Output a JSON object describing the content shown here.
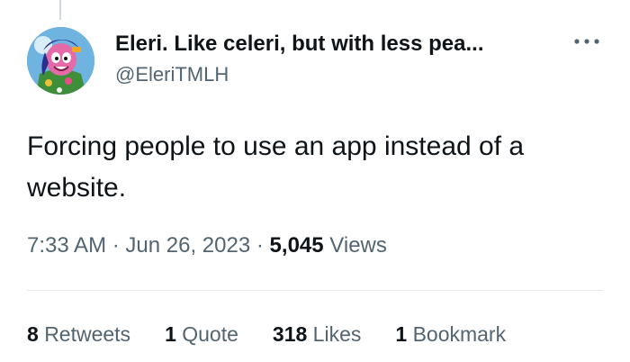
{
  "tweet": {
    "author": {
      "display_name": "Eleri. Like celeri, but with less pea...",
      "handle": "@EleriTMLH"
    },
    "text": "Forcing people to use an app instead of a website.",
    "time": "7:33 AM",
    "date": "Jun 26, 2023",
    "separator": "·",
    "views_count": "5,045",
    "views_label": "Views",
    "stats": {
      "retweets_count": "8",
      "retweets_label": "Retweets",
      "quotes_count": "1",
      "quotes_label": "Quote",
      "likes_count": "318",
      "likes_label": "Likes",
      "bookmarks_count": "1",
      "bookmarks_label": "Bookmark"
    }
  },
  "icons": {
    "more": "more-horizontal-icon"
  },
  "colors": {
    "text_primary": "#0f1419",
    "text_secondary": "#536471",
    "divider": "#e6ecf0"
  }
}
